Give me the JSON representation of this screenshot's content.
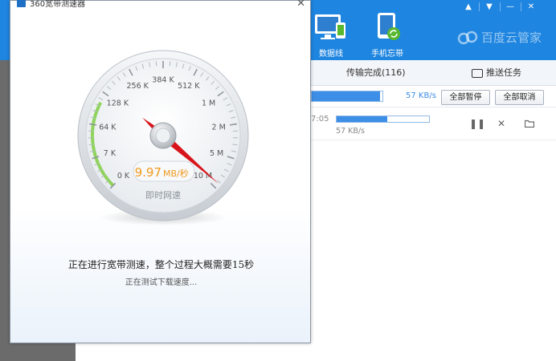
{
  "background_app": {
    "header_buttons": [
      {
        "label": "数据线",
        "icon": "monitor-phone-icon"
      },
      {
        "label": "手机忘带",
        "icon": "tablet-sync-icon"
      }
    ],
    "brand": "百度云管家",
    "window_controls": [
      "▲",
      "▼",
      "—",
      "✕"
    ],
    "tabs": {
      "transfer_done": "传输完成(116)",
      "push_task": "推送任务"
    },
    "toolbar": {
      "total_speed": "57 KB/s",
      "pause_all": "全部暂停",
      "cancel_all": "全部取消",
      "total_progress": 0.97
    },
    "task": {
      "time": "7:05",
      "speed": "57 KB/s",
      "progress": 0.55
    }
  },
  "dialog": {
    "title": "360宽带测速器",
    "close": "✕",
    "gauge": {
      "tick_labels": [
        "0 K",
        "7 K",
        "64 K",
        "128 K",
        "256 K",
        "384 K",
        "512 K",
        "1 M",
        "2 M",
        "5 M",
        "10 M"
      ],
      "reading": "9.97",
      "reading_unit": "MB/秒",
      "caption": "即时网速",
      "needle_fraction": 0.985
    },
    "status_main": "正在进行宽带测速，整个过程大概需要15秒",
    "status_sub": "正在测试下载速度..."
  },
  "colors": {
    "header_blue": "#1e85e0",
    "accent_blue": "#3d8ee6",
    "needle_red": "#d8141b",
    "reading_orange": "#f29a1d",
    "gauge_green": "#8ed45a"
  }
}
